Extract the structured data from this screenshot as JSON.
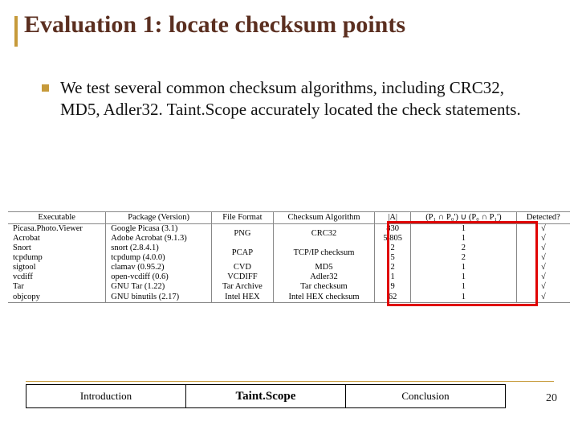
{
  "title": "Evaluation 1: locate checksum points",
  "bullet": "We test several common checksum algorithms, including CRC32, MD5, Adler32. Taint.Scope accurately  located the check statements.",
  "table": {
    "headers": [
      "Executable",
      "Package (Version)",
      "File Format",
      "Checksum Algorithm",
      "|A|",
      "(P₁ ∩ P₀') ∪ (P₀ ∩ P₁')",
      "Detected?"
    ],
    "rows": [
      {
        "exe": "Picasa.Photo.Viewer",
        "pkg": "Google Picasa (3.1)",
        "fmt": "PNG",
        "alg": "CRC32",
        "a": "830",
        "p": "1",
        "d": "√"
      },
      {
        "exe": "Acrobat",
        "pkg": "Adobe Acrobat (9.1.3)",
        "fmt": "",
        "alg": "",
        "a": "5,805",
        "p": "1",
        "d": "√"
      },
      {
        "exe": "Snort",
        "pkg": "snort (2.8.4.1)",
        "fmt": "PCAP",
        "alg": "TCP/IP checksum",
        "a": "2",
        "p": "2",
        "d": "√"
      },
      {
        "exe": "tcpdump",
        "pkg": "tcpdump (4.0.0)",
        "fmt": "",
        "alg": "",
        "a": "5",
        "p": "2",
        "d": "√"
      },
      {
        "exe": "sigtool",
        "pkg": "clamav (0.95.2)",
        "fmt": "CVD",
        "alg": "MD5",
        "a": "2",
        "p": "1",
        "d": "√"
      },
      {
        "exe": "vcdiff",
        "pkg": "open-vcdiff (0.6)",
        "fmt": "VCDIFF",
        "alg": "Adler32",
        "a": "1",
        "p": "1",
        "d": "√"
      },
      {
        "exe": "Tar",
        "pkg": "GNU Tar (1.22)",
        "fmt": "Tar Archive",
        "alg": "Tar checksum",
        "a": "9",
        "p": "1",
        "d": "√"
      },
      {
        "exe": "objcopy",
        "pkg": "GNU binutils (2.17)",
        "fmt": "Intel HEX",
        "alg": "Intel HEX checksum",
        "a": "62",
        "p": "1",
        "d": "√"
      }
    ]
  },
  "footer": {
    "items": [
      "Introduction",
      "Taint.Scope",
      "Conclusion"
    ],
    "active_index": 1
  },
  "page_number": "20",
  "chart_data": {
    "type": "table",
    "title": "Evaluation 1: locate checksum points",
    "columns": [
      "Executable",
      "Package (Version)",
      "File Format",
      "Checksum Algorithm",
      "|A|",
      "(P1∩P0')∪(P0∩P1')",
      "Detected?"
    ],
    "rows": [
      [
        "Picasa.Photo.Viewer",
        "Google Picasa (3.1)",
        "PNG",
        "CRC32",
        830,
        1,
        "yes"
      ],
      [
        "Acrobat",
        "Adobe Acrobat (9.1.3)",
        "PNG",
        "CRC32",
        5805,
        1,
        "yes"
      ],
      [
        "Snort",
        "snort (2.8.4.1)",
        "PCAP",
        "TCP/IP checksum",
        2,
        2,
        "yes"
      ],
      [
        "tcpdump",
        "tcpdump (4.0.0)",
        "PCAP",
        "TCP/IP checksum",
        5,
        2,
        "yes"
      ],
      [
        "sigtool",
        "clamav (0.95.2)",
        "CVD",
        "MD5",
        2,
        1,
        "yes"
      ],
      [
        "vcdiff",
        "open-vcdiff (0.6)",
        "VCDIFF",
        "Adler32",
        1,
        1,
        "yes"
      ],
      [
        "Tar",
        "GNU Tar (1.22)",
        "Tar Archive",
        "Tar checksum",
        9,
        1,
        "yes"
      ],
      [
        "objcopy",
        "GNU binutils (2.17)",
        "Intel HEX",
        "Intel HEX checksum",
        62,
        1,
        "yes"
      ]
    ],
    "highlight_columns": [
      "|A|",
      "(P1∩P0')∪(P0∩P1')"
    ]
  }
}
